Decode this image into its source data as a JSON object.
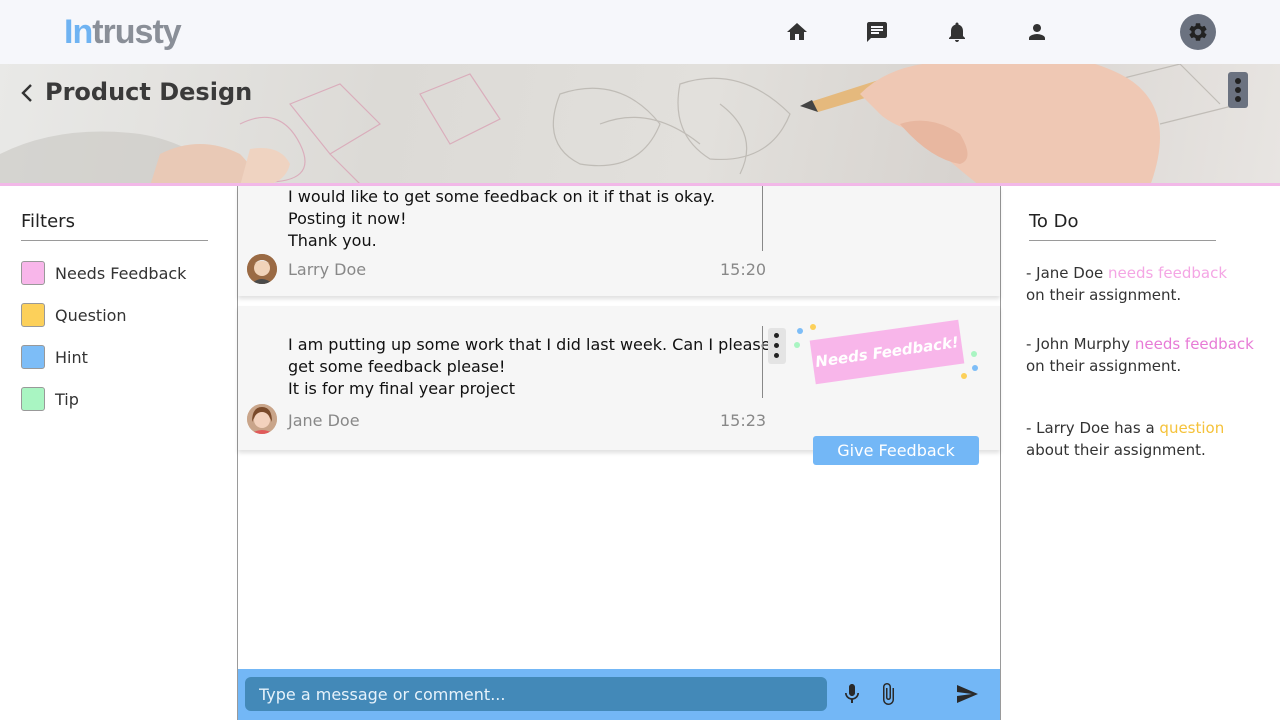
{
  "header": {
    "logo_part1": "In",
    "logo_part2": "trusty",
    "nav": [
      "home-icon",
      "chat-icon",
      "bell-icon",
      "user-icon"
    ],
    "settings_icon": "gear-icon"
  },
  "banner": {
    "title": "Product Design",
    "back_icon": "chevron-left-icon",
    "menu_icon": "more-vert-icon"
  },
  "filters": {
    "title": "Filters",
    "items": [
      {
        "label": "Needs Feedback",
        "color": "#f8b6ea"
      },
      {
        "label": "Question",
        "color": "#fcd05a"
      },
      {
        "label": "Hint",
        "color": "#7dbdf7"
      },
      {
        "label": "Tip",
        "color": "#a9f5c2"
      }
    ]
  },
  "messages": [
    {
      "lines": [
        "I would like to get some feedback on it if that is okay.",
        "Posting it now!",
        "Thank you."
      ],
      "author": "Larry Doe",
      "time": "15:20"
    },
    {
      "lines": [
        "I am putting up some work that I did last week. Can I please",
        "get some feedback please!",
        "It is for my final year project"
      ],
      "author": "Jane Doe",
      "time": "15:23",
      "tag": "Needs Feedback!",
      "action": "Give Feedback"
    }
  ],
  "composer": {
    "placeholder": "Type a message or comment...",
    "icons": [
      "mic-icon",
      "attach-icon",
      "send-icon"
    ]
  },
  "todo": {
    "title": "To Do",
    "items": [
      {
        "pre": "- Jane Doe ",
        "highlight": "needs feedback",
        "post": "on their assignment."
      },
      {
        "pre": "- John Murphy ",
        "highlight": "needs feedback",
        "post": "on their assignment."
      },
      {
        "pre": "- Larry Doe has a ",
        "highlight": "question",
        "post": "about their assignment."
      }
    ]
  }
}
